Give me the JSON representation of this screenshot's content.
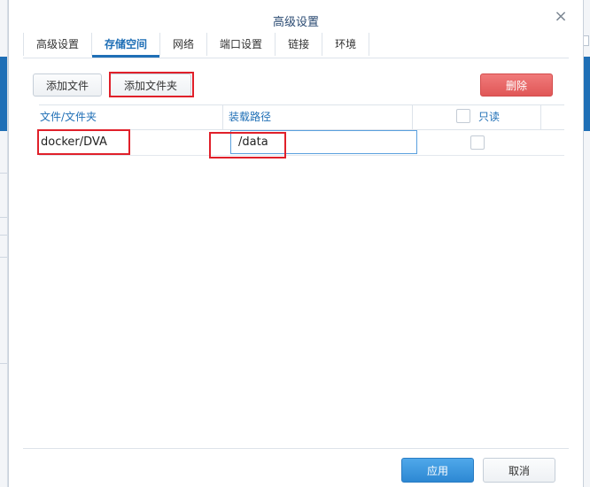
{
  "dialog": {
    "title": "高级设置",
    "close_glyph": "×"
  },
  "tabs": [
    {
      "label": "高级设置",
      "active": false
    },
    {
      "label": "存储空间",
      "active": true
    },
    {
      "label": "网络",
      "active": false
    },
    {
      "label": "端口设置",
      "active": false
    },
    {
      "label": "链接",
      "active": false
    },
    {
      "label": "环境",
      "active": false
    }
  ],
  "toolbar": {
    "add_file_label": "添加文件",
    "add_folder_label": "添加文件夹",
    "delete_label": "删除"
  },
  "table": {
    "columns": [
      "文件/文件夹",
      "装载路径",
      "只读"
    ],
    "rows": [
      {
        "file_folder": "docker/DVA",
        "mount_path": "/data",
        "read_only": false
      }
    ]
  },
  "footer": {
    "apply_label": "应用",
    "cancel_label": "取消"
  },
  "colors": {
    "accent": "#1f6fb6",
    "danger": "#e05757",
    "primary": "#2d88d3",
    "highlight_box": "#e0202a"
  }
}
